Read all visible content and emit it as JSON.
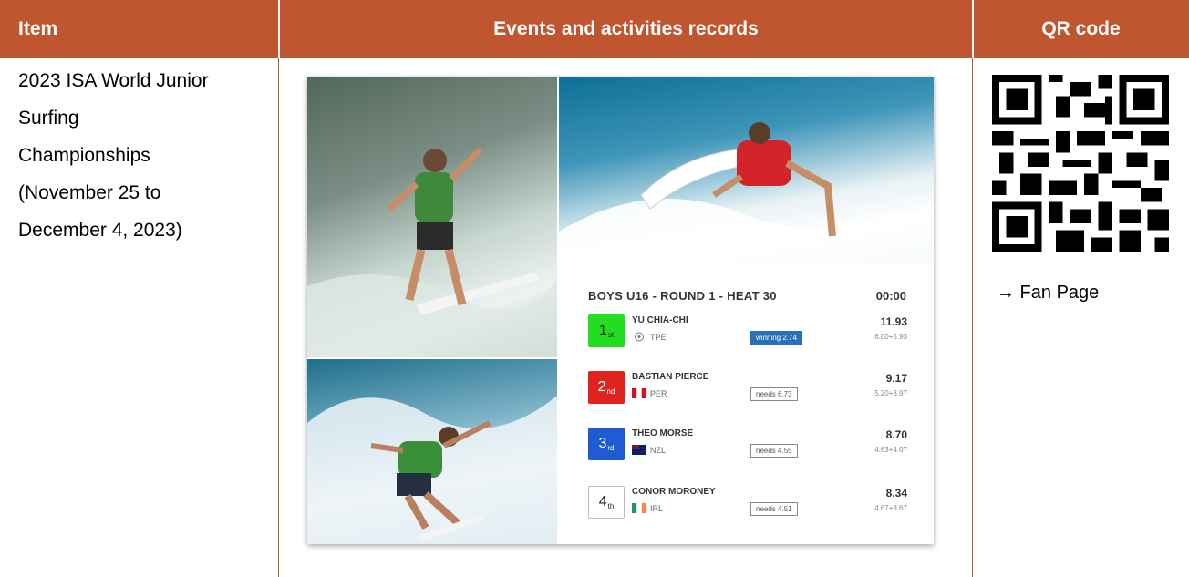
{
  "headers": {
    "item": "Item",
    "records": "Events and activities records",
    "qr": "QR code"
  },
  "item_lines": [
    "2023 ISA World Junior",
    "Surfing",
    "Championships",
    "(November 25 to",
    "December 4, 2023)"
  ],
  "scoreboard": {
    "title": "BOYS U16 - ROUND 1 - HEAT 30",
    "time": "00:00",
    "rows": [
      {
        "rank": "1",
        "suffix": "st",
        "name": "YU CHIA-CHI",
        "country": "TPE",
        "badge": "winning 2.74",
        "total": "11.93",
        "waves": "6.00+5.93"
      },
      {
        "rank": "2",
        "suffix": "nd",
        "name": "BASTIAN PIERCE",
        "country": "PER",
        "badge": "needs 6.73",
        "total": "9.17",
        "waves": "5.20+3.97"
      },
      {
        "rank": "3",
        "suffix": "rd",
        "name": "THEO MORSE",
        "country": "NZL",
        "badge": "needs 4.55",
        "total": "8.70",
        "waves": "4.63+4.07"
      },
      {
        "rank": "4",
        "suffix": "th",
        "name": "CONOR MORONEY",
        "country": "IRL",
        "badge": "needs 4.51",
        "total": "8.34",
        "waves": "4.67+3.67"
      }
    ]
  },
  "qr_caption": "→ Fan Page",
  "colors": {
    "header_bg": "#c0562f",
    "rank1": "#22dd22",
    "rank2": "#e0231f",
    "rank3": "#1f5bd1"
  }
}
